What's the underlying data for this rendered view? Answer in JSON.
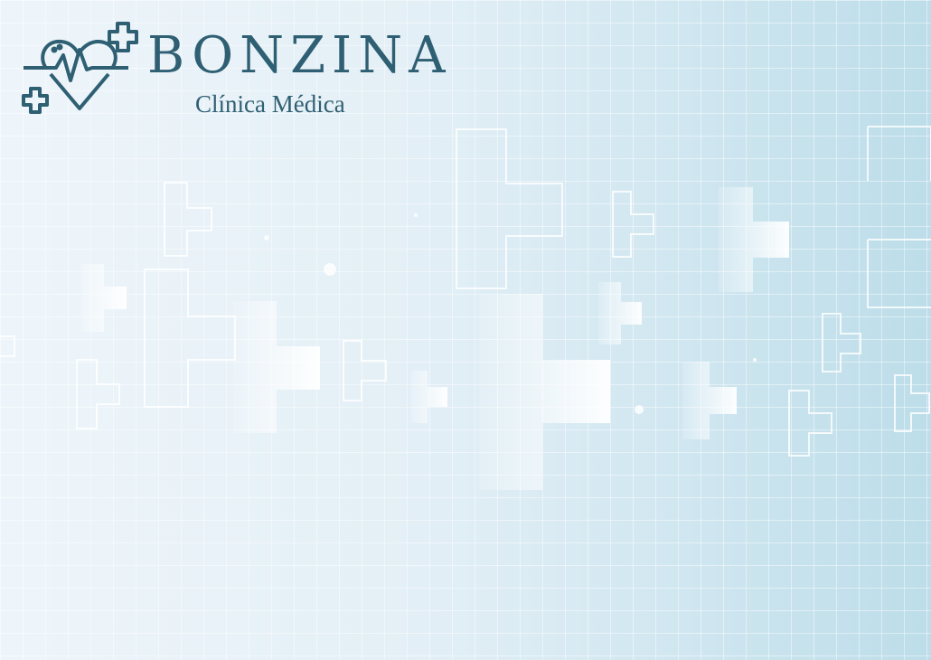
{
  "logo": {
    "name": "BONZINA",
    "subtitle": "Clínica Médica",
    "icon": "heart-pulse-plus-icon",
    "color": "#2f5f73"
  },
  "background": {
    "pattern": "grid with medical crosses",
    "colors": [
      "#eef5fa",
      "#bcdde9"
    ]
  }
}
